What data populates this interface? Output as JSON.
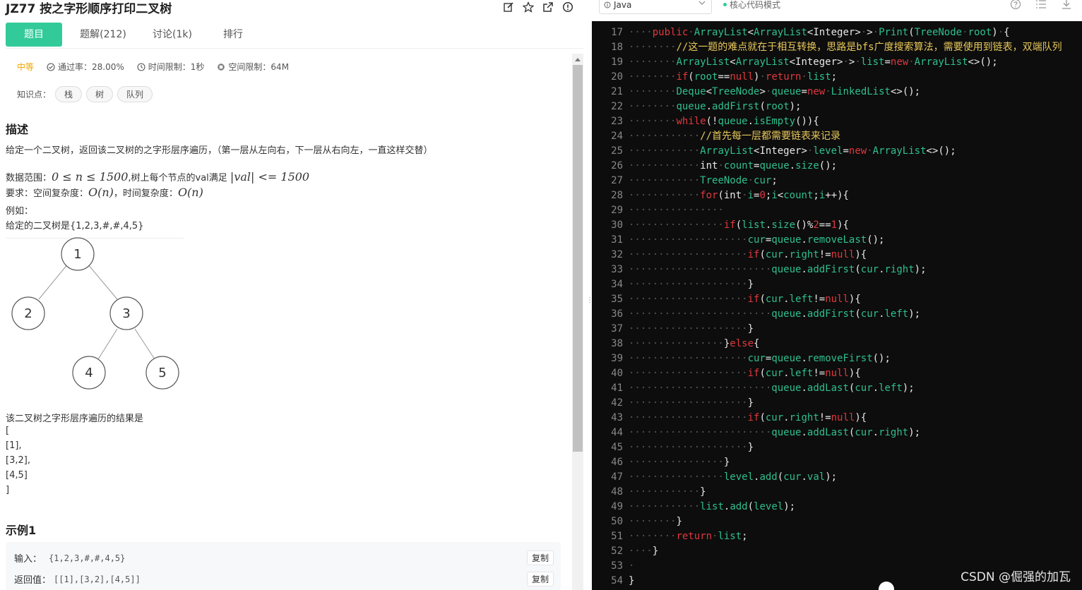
{
  "problem": {
    "title": "JZ77  按之字形顺序打印二叉树",
    "tabs": [
      "题目",
      "题解(212)",
      "讨论(1k)",
      "排行"
    ],
    "difficulty": "中等",
    "pass_rate": "通过率：28.00%",
    "time_limit": "时间限制：1秒",
    "space_limit": "空间限制：64M",
    "knowledge_label": "知识点：",
    "tags": [
      "栈",
      "树",
      "队列"
    ],
    "desc_heading": "描述",
    "desc_text": "给定一个二叉树，返回该二叉树的之字形层序遍历，（第一层从左向右，下一层从右向左，一直这样交替）",
    "range_prefix": "数据范围：",
    "range_math1": "0 ≤ n ≤ 1500",
    "range_mid": ",树上每个节点的val满足 ",
    "range_math2": "|val| <= 1500",
    "req_prefix": "要求：空间复杂度：",
    "req_math1": "O(n)",
    "req_mid": "，时间复杂度：",
    "req_math2": "O(n)",
    "example_label": "例如：",
    "tree_given": "给定的二叉树是{1,2,3,#,#,4,5}",
    "tree_nodes": [
      "1",
      "2",
      "3",
      "4",
      "5"
    ],
    "result_intro": "该二叉树之字形层序遍历的结果是",
    "result_lines": [
      "[",
      "[1],",
      "[3,2],",
      "[4,5]",
      "]"
    ],
    "example_heading": "示例1",
    "input_label": "输入：",
    "input_value": "{1,2,3,#,#,4,5}",
    "output_label": "返回值：",
    "output_value": "[[1],[3,2],[4,5]]",
    "copy_label": "复制"
  },
  "editor": {
    "language": "Java",
    "mode": "核心代码模式",
    "watermark": "CSDN @倔强的加瓦",
    "lines": [
      {
        "n": "17",
        "ws": "····",
        "code": [
          [
            "kw",
            "public"
          ],
          [
            "ws",
            "·"
          ],
          [
            "type",
            "ArrayList"
          ],
          [
            "op",
            "<"
          ],
          [
            "type",
            "ArrayList"
          ],
          [
            "op",
            "<Integer>"
          ],
          [
            "ws",
            "·"
          ],
          [
            "op",
            ">"
          ],
          [
            "ws",
            "·"
          ],
          [
            "id",
            "Print"
          ],
          [
            "op",
            "("
          ],
          [
            "type",
            "TreeNode"
          ],
          [
            "ws",
            "·"
          ],
          [
            "id",
            "root"
          ],
          [
            "op",
            ")"
          ],
          [
            "ws",
            "·"
          ],
          [
            "op",
            "{"
          ]
        ]
      },
      {
        "n": "18",
        "ws": "········",
        "code": [
          [
            "cm",
            "//这一题的难点就在于相互转换，思路是bfs广度搜索算法，需要使用到链表，双端队列"
          ]
        ]
      },
      {
        "n": "19",
        "ws": "········",
        "code": [
          [
            "type",
            "ArrayList"
          ],
          [
            "op",
            "<"
          ],
          [
            "type",
            "ArrayList"
          ],
          [
            "op",
            "<Integer>"
          ],
          [
            "ws",
            "·"
          ],
          [
            "op",
            ">"
          ],
          [
            "ws",
            "·"
          ],
          [
            "id",
            "list"
          ],
          [
            "op",
            "="
          ],
          [
            "kw",
            "new"
          ],
          [
            "ws",
            "·"
          ],
          [
            "type",
            "ArrayList"
          ],
          [
            "op",
            "<>();"
          ]
        ]
      },
      {
        "n": "20",
        "ws": "········",
        "code": [
          [
            "kw",
            "if"
          ],
          [
            "op",
            "("
          ],
          [
            "id",
            "root"
          ],
          [
            "op",
            "=="
          ],
          [
            "kw",
            "null"
          ],
          [
            "op",
            ")"
          ],
          [
            "ws",
            "·"
          ],
          [
            "kw",
            "return"
          ],
          [
            "ws",
            "·"
          ],
          [
            "id",
            "list"
          ],
          [
            "op",
            ";"
          ]
        ]
      },
      {
        "n": "21",
        "ws": "········",
        "code": [
          [
            "type",
            "Deque"
          ],
          [
            "op",
            "<"
          ],
          [
            "type",
            "TreeNode"
          ],
          [
            "op",
            ">"
          ],
          [
            "ws",
            "·"
          ],
          [
            "id",
            "queue"
          ],
          [
            "op",
            "="
          ],
          [
            "kw",
            "new"
          ],
          [
            "ws",
            "·"
          ],
          [
            "type",
            "LinkedList"
          ],
          [
            "op",
            "<>();"
          ]
        ]
      },
      {
        "n": "22",
        "ws": "········",
        "code": [
          [
            "id",
            "queue"
          ],
          [
            "op",
            "."
          ],
          [
            "id",
            "addFirst"
          ],
          [
            "op",
            "("
          ],
          [
            "id",
            "root"
          ],
          [
            "op",
            ");"
          ]
        ]
      },
      {
        "n": "23",
        "ws": "········",
        "code": [
          [
            "kw",
            "while"
          ],
          [
            "op",
            "(!"
          ],
          [
            "id",
            "queue"
          ],
          [
            "op",
            "."
          ],
          [
            "id",
            "isEmpty"
          ],
          [
            "op",
            "()){"
          ]
        ]
      },
      {
        "n": "24",
        "ws": "············",
        "code": [
          [
            "cm",
            "//首先每一层都需要链表来记录"
          ]
        ]
      },
      {
        "n": "25",
        "ws": "············",
        "code": [
          [
            "type",
            "ArrayList"
          ],
          [
            "op",
            "<Integer>"
          ],
          [
            "ws",
            "·"
          ],
          [
            "id",
            "level"
          ],
          [
            "op",
            "="
          ],
          [
            "kw",
            "new"
          ],
          [
            "ws",
            "·"
          ],
          [
            "type",
            "ArrayList"
          ],
          [
            "op",
            "<>();"
          ]
        ]
      },
      {
        "n": "26",
        "ws": "············",
        "code": [
          [
            "op",
            "int"
          ],
          [
            "ws",
            "·"
          ],
          [
            "id",
            "count"
          ],
          [
            "op",
            "="
          ],
          [
            "id",
            "queue"
          ],
          [
            "op",
            "."
          ],
          [
            "id",
            "size"
          ],
          [
            "op",
            "();"
          ]
        ]
      },
      {
        "n": "27",
        "ws": "············",
        "code": [
          [
            "type",
            "TreeNode"
          ],
          [
            "ws",
            "·"
          ],
          [
            "id",
            "cur"
          ],
          [
            "op",
            ";"
          ]
        ]
      },
      {
        "n": "28",
        "ws": "············",
        "code": [
          [
            "kw",
            "for"
          ],
          [
            "op",
            "(int"
          ],
          [
            "ws",
            "·"
          ],
          [
            "id",
            "i"
          ],
          [
            "op",
            "="
          ],
          [
            "num",
            "0"
          ],
          [
            "op",
            ";"
          ],
          [
            "id",
            "i"
          ],
          [
            "op",
            "<"
          ],
          [
            "id",
            "count"
          ],
          [
            "op",
            ";"
          ],
          [
            "id",
            "i"
          ],
          [
            "op",
            "++){"
          ]
        ]
      },
      {
        "n": "29",
        "ws": "················",
        "code": []
      },
      {
        "n": "30",
        "ws": "················",
        "code": [
          [
            "kw",
            "if"
          ],
          [
            "op",
            "("
          ],
          [
            "id",
            "list"
          ],
          [
            "op",
            "."
          ],
          [
            "id",
            "size"
          ],
          [
            "op",
            "()%"
          ],
          [
            "num",
            "2"
          ],
          [
            "op",
            "=="
          ],
          [
            "num",
            "1"
          ],
          [
            "op",
            "){"
          ]
        ]
      },
      {
        "n": "31",
        "ws": "····················",
        "code": [
          [
            "id",
            "cur"
          ],
          [
            "op",
            "="
          ],
          [
            "id",
            "queue"
          ],
          [
            "op",
            "."
          ],
          [
            "id",
            "removeLast"
          ],
          [
            "op",
            "();"
          ]
        ]
      },
      {
        "n": "32",
        "ws": "····················",
        "code": [
          [
            "kw",
            "if"
          ],
          [
            "op",
            "("
          ],
          [
            "id",
            "cur"
          ],
          [
            "op",
            "."
          ],
          [
            "id",
            "right"
          ],
          [
            "op",
            "!="
          ],
          [
            "kw",
            "null"
          ],
          [
            "op",
            "){"
          ]
        ]
      },
      {
        "n": "33",
        "ws": "························",
        "code": [
          [
            "id",
            "queue"
          ],
          [
            "op",
            "."
          ],
          [
            "id",
            "addFirst"
          ],
          [
            "op",
            "("
          ],
          [
            "id",
            "cur"
          ],
          [
            "op",
            "."
          ],
          [
            "id",
            "right"
          ],
          [
            "op",
            ");"
          ]
        ]
      },
      {
        "n": "34",
        "ws": "····················",
        "code": [
          [
            "op",
            "}"
          ]
        ]
      },
      {
        "n": "35",
        "ws": "····················",
        "code": [
          [
            "kw",
            "if"
          ],
          [
            "op",
            "("
          ],
          [
            "id",
            "cur"
          ],
          [
            "op",
            "."
          ],
          [
            "id",
            "left"
          ],
          [
            "op",
            "!="
          ],
          [
            "kw",
            "null"
          ],
          [
            "op",
            "){"
          ]
        ]
      },
      {
        "n": "36",
        "ws": "························",
        "code": [
          [
            "id",
            "queue"
          ],
          [
            "op",
            "."
          ],
          [
            "id",
            "addFirst"
          ],
          [
            "op",
            "("
          ],
          [
            "id",
            "cur"
          ],
          [
            "op",
            "."
          ],
          [
            "id",
            "left"
          ],
          [
            "op",
            ");"
          ]
        ]
      },
      {
        "n": "37",
        "ws": "····················",
        "code": [
          [
            "op",
            "}"
          ]
        ]
      },
      {
        "n": "38",
        "ws": "················",
        "code": [
          [
            "op",
            "}"
          ],
          [
            "kw",
            "else"
          ],
          [
            "op",
            "{"
          ]
        ]
      },
      {
        "n": "39",
        "ws": "····················",
        "code": [
          [
            "id",
            "cur"
          ],
          [
            "op",
            "="
          ],
          [
            "id",
            "queue"
          ],
          [
            "op",
            "."
          ],
          [
            "id",
            "removeFirst"
          ],
          [
            "op",
            "();"
          ]
        ]
      },
      {
        "n": "40",
        "ws": "····················",
        "code": [
          [
            "kw",
            "if"
          ],
          [
            "op",
            "("
          ],
          [
            "id",
            "cur"
          ],
          [
            "op",
            "."
          ],
          [
            "id",
            "left"
          ],
          [
            "op",
            "!="
          ],
          [
            "kw",
            "null"
          ],
          [
            "op",
            "){"
          ]
        ]
      },
      {
        "n": "41",
        "ws": "························",
        "code": [
          [
            "id",
            "queue"
          ],
          [
            "op",
            "."
          ],
          [
            "id",
            "addLast"
          ],
          [
            "op",
            "("
          ],
          [
            "id",
            "cur"
          ],
          [
            "op",
            "."
          ],
          [
            "id",
            "left"
          ],
          [
            "op",
            ");"
          ]
        ]
      },
      {
        "n": "42",
        "ws": "····················",
        "code": [
          [
            "op",
            "}"
          ]
        ]
      },
      {
        "n": "43",
        "ws": "····················",
        "code": [
          [
            "kw",
            "if"
          ],
          [
            "op",
            "("
          ],
          [
            "id",
            "cur"
          ],
          [
            "op",
            "."
          ],
          [
            "id",
            "right"
          ],
          [
            "op",
            "!="
          ],
          [
            "kw",
            "null"
          ],
          [
            "op",
            "){"
          ]
        ]
      },
      {
        "n": "44",
        "ws": "························",
        "code": [
          [
            "id",
            "queue"
          ],
          [
            "op",
            "."
          ],
          [
            "id",
            "addLast"
          ],
          [
            "op",
            "("
          ],
          [
            "id",
            "cur"
          ],
          [
            "op",
            "."
          ],
          [
            "id",
            "right"
          ],
          [
            "op",
            ");"
          ]
        ]
      },
      {
        "n": "45",
        "ws": "····················",
        "code": [
          [
            "op",
            "}"
          ]
        ]
      },
      {
        "n": "46",
        "ws": "················",
        "code": [
          [
            "op",
            "}"
          ]
        ]
      },
      {
        "n": "47",
        "ws": "················",
        "code": [
          [
            "id",
            "level"
          ],
          [
            "op",
            "."
          ],
          [
            "id",
            "add"
          ],
          [
            "op",
            "("
          ],
          [
            "id",
            "cur"
          ],
          [
            "op",
            "."
          ],
          [
            "id",
            "val"
          ],
          [
            "op",
            ");"
          ]
        ]
      },
      {
        "n": "48",
        "ws": "············",
        "code": [
          [
            "op",
            "}"
          ]
        ]
      },
      {
        "n": "49",
        "ws": "············",
        "code": [
          [
            "id",
            "list"
          ],
          [
            "op",
            "."
          ],
          [
            "id",
            "add"
          ],
          [
            "op",
            "("
          ],
          [
            "id",
            "level"
          ],
          [
            "op",
            ");"
          ]
        ]
      },
      {
        "n": "50",
        "ws": "········",
        "code": [
          [
            "op",
            "}"
          ]
        ]
      },
      {
        "n": "51",
        "ws": "········",
        "code": [
          [
            "kw",
            "return"
          ],
          [
            "ws",
            "·"
          ],
          [
            "id",
            "list"
          ],
          [
            "op",
            ";"
          ]
        ]
      },
      {
        "n": "52",
        "ws": "····",
        "code": [
          [
            "op",
            "}"
          ]
        ]
      },
      {
        "n": "53",
        "ws": "·",
        "code": []
      },
      {
        "n": "54",
        "ws": "",
        "code": [
          [
            "op",
            "}"
          ]
        ]
      }
    ]
  },
  "colors": {
    "accent": "#32ca99",
    "difficulty": "#f0a500",
    "editor_bg": "#0d0d0d",
    "keyword": "#e0383e",
    "identifier": "#2fbf8f",
    "comment": "#e8c85a"
  }
}
